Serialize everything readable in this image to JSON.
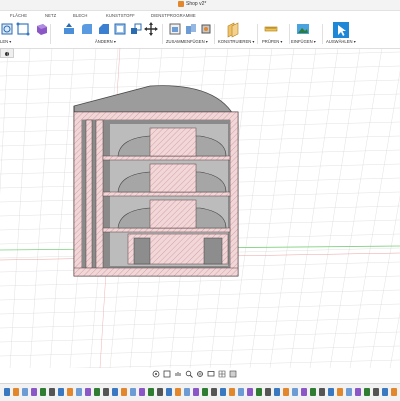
{
  "window": {
    "title": "Shop v2*",
    "icon": "document-icon",
    "accent": "#e3872d"
  },
  "tabs": [
    {
      "label": "FLÄCHE"
    },
    {
      "label": "NETZ"
    },
    {
      "label": "BLECH"
    },
    {
      "label": "KUNSTSTOFF"
    },
    {
      "label": "DIENSTPROGRAMME"
    }
  ],
  "toolbar": {
    "groups": [
      {
        "label": "LEN ▾"
      },
      {
        "label": "ÄNDERN ▾"
      },
      {
        "label": "ZUSAMMENFÜGEN ▾"
      },
      {
        "label": "KONSTRUIEREN ▾"
      },
      {
        "label": "PRÜFEN ▾"
      },
      {
        "label": "EINFÜGEN ▾"
      },
      {
        "label": "AUSWÄHLEN ▾"
      }
    ]
  },
  "viewport": {
    "background": "#ffffff",
    "grid_color": "#d9d9d9",
    "axis_red": "#e07070",
    "axis_green": "#7fcf7f",
    "section_fill": "#f2d7d9",
    "section_hatch": "#c58a8e",
    "body_grey": "#7b7b7b",
    "model": "section-view-shelf-cabinet"
  },
  "navbar": {
    "icons": [
      "orbit-icon",
      "look-at-icon",
      "pan-icon",
      "zoom-icon",
      "fit-icon",
      "display-settings-icon",
      "grid-icon",
      "viewports-icon"
    ]
  },
  "timeline": {
    "count": 44
  }
}
